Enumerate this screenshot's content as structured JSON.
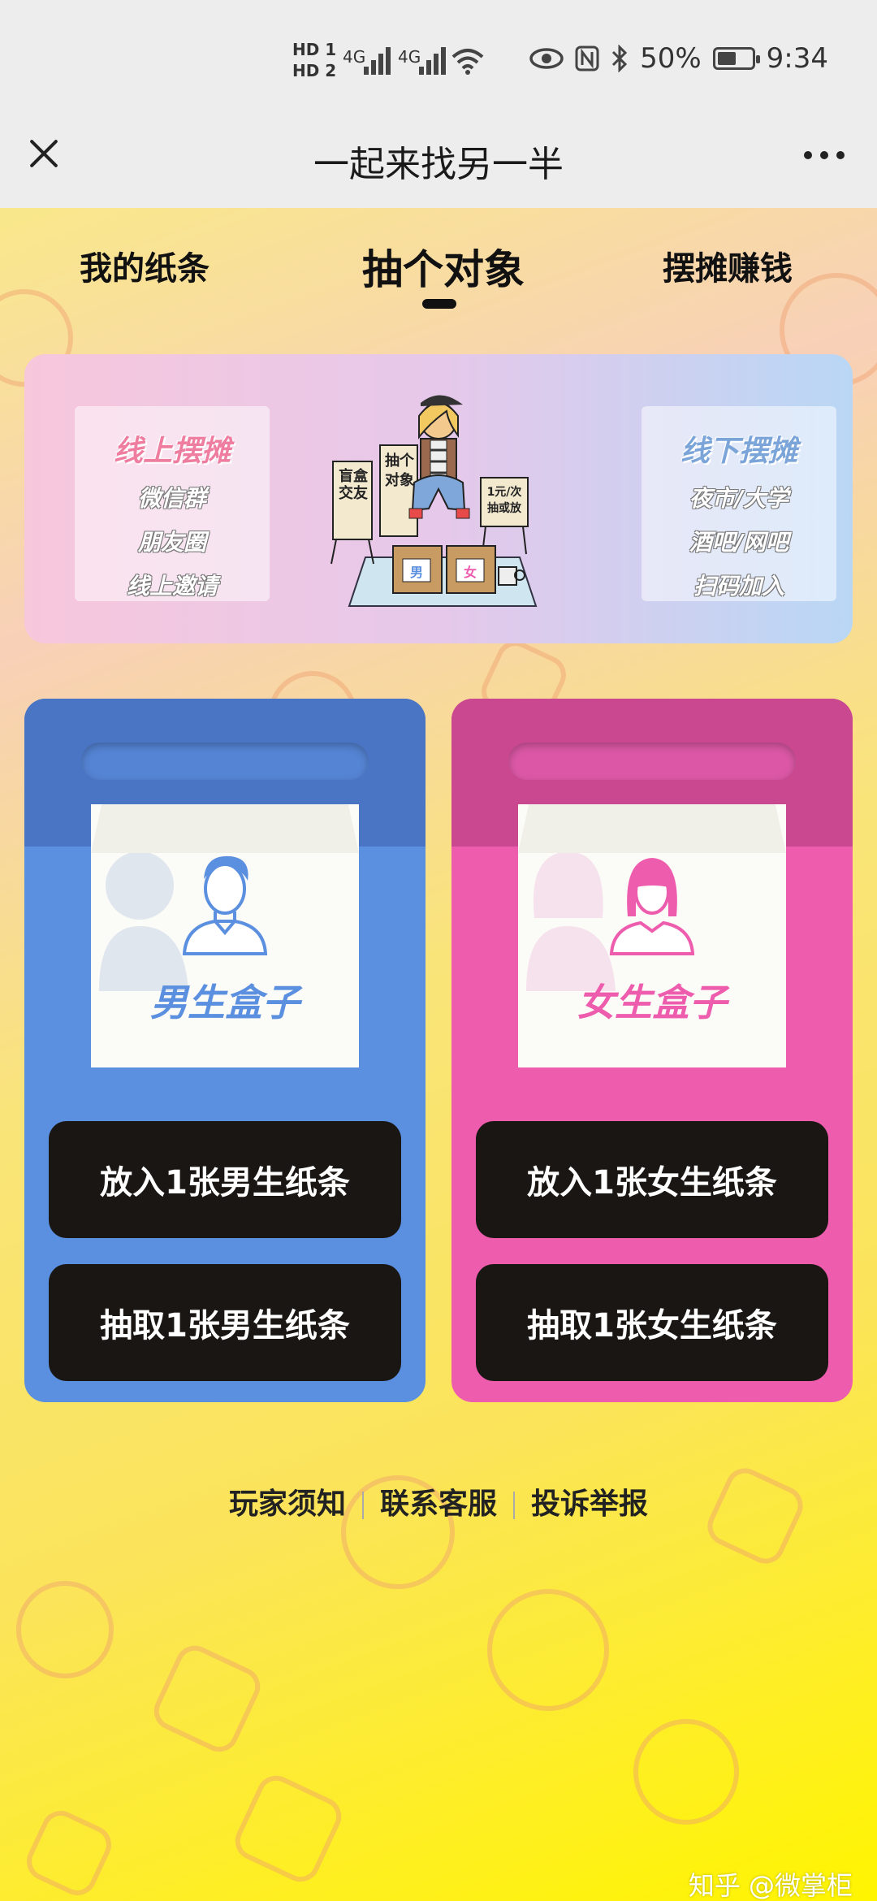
{
  "status_bar": {
    "hd1": "HD 1",
    "hd2": "HD 2",
    "net1": "4G",
    "net2": "4G",
    "battery": "50%",
    "time": "9:34"
  },
  "titlebar": {
    "title": "一起来找另一半"
  },
  "tabs": [
    {
      "label": "我的纸条"
    },
    {
      "label": "抽个对象"
    },
    {
      "label": "摆摊赚钱"
    }
  ],
  "banner": {
    "left": {
      "title": "线上摆摊",
      "lines": [
        "微信群",
        "朋友圈",
        "线上邀请"
      ]
    },
    "right": {
      "title": "线下摆摊",
      "lines": [
        "夜市/大学",
        "酒吧/网吧",
        "扫码加入"
      ]
    },
    "sign_left": "盲盒交友",
    "sign_mid": "抽个对象",
    "sign_right": "1元/次 抽或放",
    "box_male": "男",
    "box_female": "女"
  },
  "boxes": {
    "male": {
      "label": "男生盒子",
      "put": "放入1张男生纸条",
      "draw": "抽取1张男生纸条"
    },
    "female": {
      "label": "女生盒子",
      "put": "放入1张女生纸条",
      "draw": "抽取1张女生纸条"
    }
  },
  "links": [
    "玩家须知",
    "联系客服",
    "投诉举报"
  ],
  "watermark": "知乎 @微掌柜",
  "colors": {
    "male": "#5b8fdf",
    "female": "#ee5cae",
    "button": "#1a1613"
  }
}
